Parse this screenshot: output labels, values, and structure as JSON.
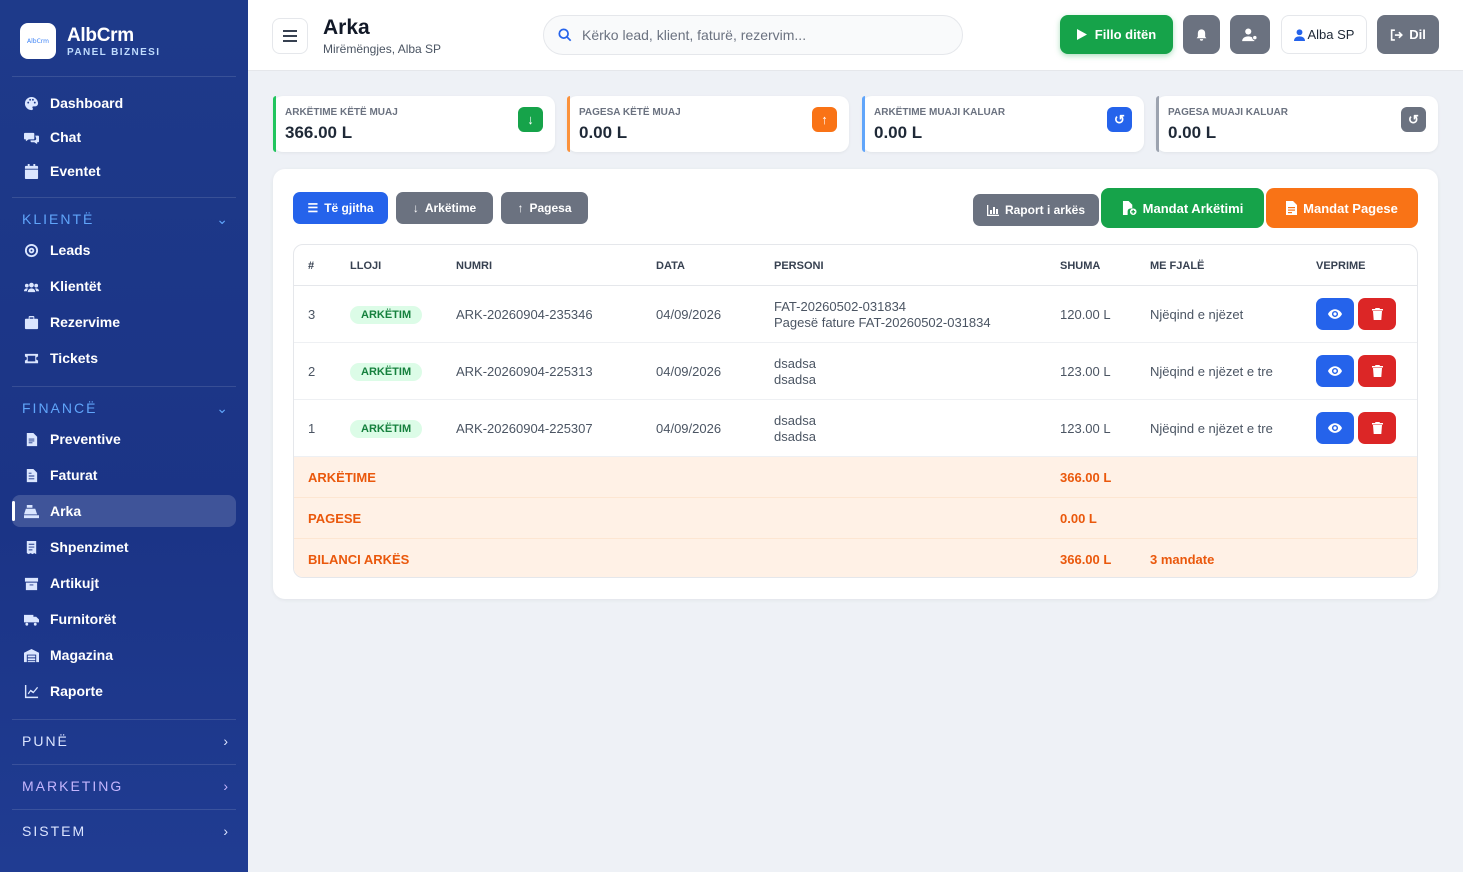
{
  "brand": {
    "logo_text": "AlbCrm",
    "name": "AlbCrm",
    "sub": "PANEL BIZNESI"
  },
  "sidebar": {
    "top_items": [
      {
        "label": "Dashboard",
        "icon": "palette-icon"
      },
      {
        "label": "Chat",
        "icon": "chat-icon"
      },
      {
        "label": "Eventet",
        "icon": "calendar-icon"
      }
    ],
    "sections": [
      {
        "title": "KLIENTË",
        "state": "open",
        "items": [
          {
            "label": "Leads",
            "icon": "target-icon"
          },
          {
            "label": "Klientët",
            "icon": "users-icon"
          },
          {
            "label": "Rezervime",
            "icon": "briefcase-icon"
          },
          {
            "label": "Tickets",
            "icon": "ticket-icon"
          }
        ]
      },
      {
        "title": "FINANCË",
        "state": "open",
        "items": [
          {
            "label": "Preventive",
            "icon": "file-icon"
          },
          {
            "label": "Faturat",
            "icon": "invoice-icon"
          },
          {
            "label": "Arka",
            "icon": "cash-register-icon",
            "active": true
          },
          {
            "label": "Shpenzimet",
            "icon": "receipt-icon"
          },
          {
            "label": "Artikujt",
            "icon": "box-icon"
          },
          {
            "label": "Furnitorët",
            "icon": "truck-icon"
          },
          {
            "label": "Magazina",
            "icon": "warehouse-icon"
          },
          {
            "label": "Raporte",
            "icon": "chart-line-icon"
          }
        ]
      },
      {
        "title": "PUNË",
        "state": "closed"
      },
      {
        "title": "MARKETING",
        "state": "closed"
      },
      {
        "title": "SISTEM",
        "state": "closed"
      }
    ]
  },
  "header": {
    "title": "Arka",
    "subtitle": "Mirëmëngjes, Alba SP",
    "search_placeholder": "Kërko lead, klient, faturë, rezervim...",
    "start_day": "Fillo ditën",
    "user": "Alba SP",
    "exit": "Dil"
  },
  "stats": [
    {
      "label": "ARKËTIME KËTË MUAJ",
      "value": "366.00 L",
      "color": "#16a34a",
      "icon": "arrow-down-icon"
    },
    {
      "label": "PAGESA KËTË MUAJ",
      "value": "0.00 L",
      "color": "#f97316",
      "icon": "arrow-up-icon"
    },
    {
      "label": "ARKËTIME MUAJI KALUAR",
      "value": "0.00 L",
      "color": "#2563eb",
      "icon": "history-icon"
    },
    {
      "label": "PAGESA MUAJI KALUAR",
      "value": "0.00 L",
      "color": "#6b7280",
      "icon": "history-icon"
    }
  ],
  "toolbar": {
    "all": "Të gjitha",
    "income": "Arkëtime",
    "payments": "Pagesa",
    "report": "Raport i arkës",
    "mandat_in": "Mandat Arkëtimi",
    "mandat_out": "Mandat Pagese"
  },
  "table": {
    "columns": [
      "#",
      "LLOJI",
      "NUMRI",
      "DATA",
      "PERSONI",
      "SHUMA",
      "ME FJALË",
      "VEPRIME"
    ],
    "rows": [
      {
        "n": "3",
        "type": "ARKËTIM",
        "number": "ARK-20260904-235346",
        "date": "04/09/2026",
        "person": "FAT-20260502-031834",
        "person2": "Pagesë fature FAT-20260502-031834",
        "amount": "120.00 L",
        "words": "Njëqind e njëzet"
      },
      {
        "n": "2",
        "type": "ARKËTIM",
        "number": "ARK-20260904-225313",
        "date": "04/09/2026",
        "person": "dsadsa",
        "person2": "dsadsa",
        "amount": "123.00 L",
        "words": "Njëqind e njëzet e tre"
      },
      {
        "n": "1",
        "type": "ARKËTIM",
        "number": "ARK-20260904-225307",
        "date": "04/09/2026",
        "person": "dsadsa",
        "person2": "dsadsa",
        "amount": "123.00 L",
        "words": "Njëqind e njëzet e tre"
      }
    ],
    "summary": [
      {
        "label": "ARKËTIME",
        "value": "366.00 L",
        "extra": ""
      },
      {
        "label": "PAGESE",
        "value": "0.00 L",
        "extra": ""
      },
      {
        "label": "BILANCI ARKËS",
        "value": "366.00 L",
        "extra": "3 mandate"
      }
    ]
  }
}
